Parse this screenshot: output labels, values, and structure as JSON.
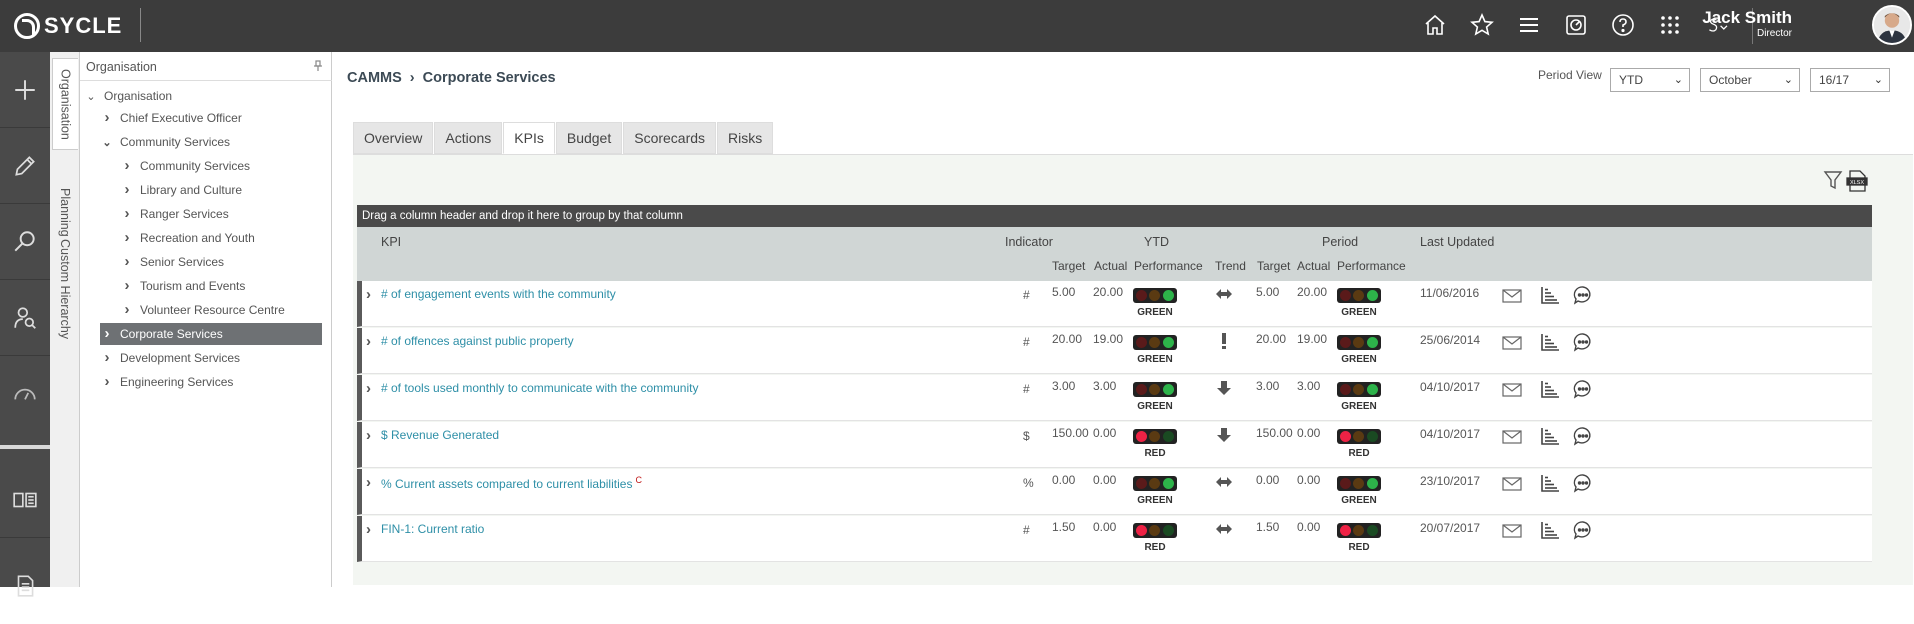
{
  "brand": {
    "name": "SYCLE"
  },
  "user": {
    "name": "Jack Smith",
    "role": "Director"
  },
  "topbar_icons": [
    "home-icon",
    "star-icon",
    "menu-icon",
    "dashboard-icon",
    "help-icon",
    "apps-grid-icon",
    "sycle-menu-icon"
  ],
  "rail_icons": [
    "add-icon",
    "edit-icon",
    "search-icon",
    "user-search-icon",
    "gauge-icon",
    "report-icon",
    "document-icon"
  ],
  "vtabs": {
    "organisation": "Organisation",
    "planning": "Planning",
    "custom": "Custom Hierarchy"
  },
  "tree": {
    "header": "Organisation",
    "root": "Organisation",
    "items": [
      {
        "label": "Chief Executive Officer",
        "level": 1,
        "expanded": false
      },
      {
        "label": "Community Services",
        "level": 1,
        "expanded": true
      },
      {
        "label": "Community Services",
        "level": 2,
        "expanded": false
      },
      {
        "label": "Library and Culture",
        "level": 2,
        "expanded": false
      },
      {
        "label": "Ranger Services",
        "level": 2,
        "expanded": false
      },
      {
        "label": "Recreation and Youth",
        "level": 2,
        "expanded": false
      },
      {
        "label": "Senior Services",
        "level": 2,
        "expanded": false
      },
      {
        "label": "Tourism and Events",
        "level": 2,
        "expanded": false
      },
      {
        "label": "Volunteer Resource Centre",
        "level": 2,
        "expanded": false
      },
      {
        "label": "Corporate Services",
        "level": 1,
        "expanded": false,
        "selected": true
      },
      {
        "label": "Development Services",
        "level": 1,
        "expanded": false
      },
      {
        "label": "Engineering Services",
        "level": 1,
        "expanded": false
      }
    ]
  },
  "breadcrumb": {
    "root": "CAMMS",
    "current": "Corporate Services"
  },
  "period": {
    "label": "Period View",
    "view": "YTD",
    "month": "October",
    "year": "16/17"
  },
  "tabs": [
    "Overview",
    "Actions",
    "KPIs",
    "Budget",
    "Scorecards",
    "Risks"
  ],
  "active_tab": "KPIs",
  "group_hint": "Drag a column header and drop it here to group by that column",
  "columns": {
    "kpi": "KPI",
    "indicator": "Indicator",
    "ytd": "YTD",
    "period": "Period",
    "last_updated": "Last Updated",
    "target": "Target",
    "actual": "Actual",
    "performance": "Performance",
    "trend": "Trend"
  },
  "rows": [
    {
      "kpi": "# of engagement events with the community",
      "flag": "",
      "indicator": "#",
      "ytd_target": "5.00",
      "ytd_actual": "20.00",
      "ytd_status": "GREEN",
      "trend": "flat",
      "p_target": "5.00",
      "p_actual": "20.00",
      "p_status": "GREEN",
      "updated": "11/06/2016"
    },
    {
      "kpi": "# of offences against public property",
      "flag": "",
      "indicator": "#",
      "ytd_target": "20.00",
      "ytd_actual": "19.00",
      "ytd_status": "GREEN",
      "trend": "alert",
      "p_target": "20.00",
      "p_actual": "19.00",
      "p_status": "GREEN",
      "updated": "25/06/2014"
    },
    {
      "kpi": "# of tools used monthly to communicate with the community",
      "flag": "",
      "indicator": "#",
      "ytd_target": "3.00",
      "ytd_actual": "3.00",
      "ytd_status": "GREEN",
      "trend": "down",
      "p_target": "3.00",
      "p_actual": "3.00",
      "p_status": "GREEN",
      "updated": "04/10/2017"
    },
    {
      "kpi": "$ Revenue Generated",
      "flag": "",
      "indicator": "$",
      "ytd_target": "150.00",
      "ytd_actual": "0.00",
      "ytd_status": "RED",
      "trend": "down",
      "p_target": "150.00",
      "p_actual": "0.00",
      "p_status": "RED",
      "updated": "04/10/2017"
    },
    {
      "kpi": "% Current assets compared to current liabilities",
      "flag": "C",
      "indicator": "%",
      "ytd_target": "0.00",
      "ytd_actual": "0.00",
      "ytd_status": "GREEN",
      "trend": "flat",
      "p_target": "0.00",
      "p_actual": "0.00",
      "p_status": "GREEN",
      "updated": "23/10/2017"
    },
    {
      "kpi": "FIN-1: Current ratio",
      "flag": "",
      "indicator": "#",
      "ytd_target": "1.50",
      "ytd_actual": "0.00",
      "ytd_status": "RED",
      "trend": "flat",
      "p_target": "1.50",
      "p_actual": "0.00",
      "p_status": "RED",
      "updated": "20/07/2017"
    }
  ],
  "colors": {
    "green": "#2db34a",
    "red": "#ee2245",
    "dim_red": "#5a1a1a",
    "dim_amber": "#5a3a12",
    "dim_green": "#1a4a22",
    "link": "#2e8fa7"
  }
}
